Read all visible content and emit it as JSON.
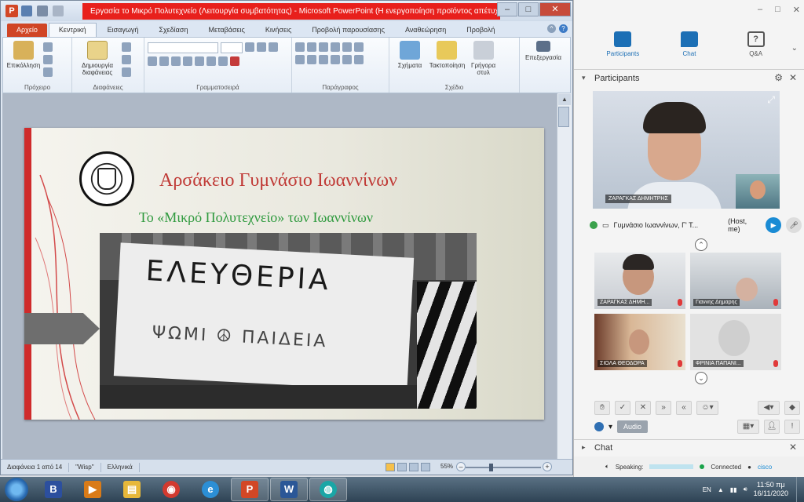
{
  "powerpoint": {
    "app_icon": "P",
    "title": "Εργασία το Μικρό Πολυτεχνείο (Λειτουργία συμβατότητας) - Microsoft PowerPoint (Η ενεργοποίηση προϊόντος απέτυχε)",
    "tabs": [
      "Αρχείο",
      "Κεντρική",
      "Εισαγωγή",
      "Σχεδίαση",
      "Μεταβάσεις",
      "Κινήσεις",
      "Προβολή παρουσίασης",
      "Αναθεώρηση",
      "Προβολή"
    ],
    "active_tab_index": 1,
    "ribbon": {
      "clipboard": {
        "paste_label": "Επικόλληση",
        "group_label": "Πρόχειρο"
      },
      "slides": {
        "new_slide_label": "Δημιουργία διαφάνειας",
        "group_label": "Διαφάνειες"
      },
      "font": {
        "group_label": "Γραμματοσειρά"
      },
      "paragraph": {
        "group_label": "Παράγραφος"
      },
      "drawing": {
        "shapes_label": "Σχήματα",
        "arrange_label": "Τακτοποίηση",
        "quick_styles_label": "Γρήγορα στυλ",
        "group_label": "Σχέδιο"
      },
      "editing": {
        "label": "Επεξεργασία"
      }
    },
    "slide": {
      "heading": "Αρσάκειο Γυμνάσιο Ιωαννίνων",
      "subheading": "Το «Μικρό Πολυτεχνείο» των Ιωαννίνων",
      "photo_banner_text": "ΕΛΕΥΘΕΡΙΑ",
      "photo_banner_text2": "ΨΩΜΙ   ☮   ΠΑΙΔΕΙΑ"
    },
    "status": {
      "slide_counter": "Διαφάνεια 1 από 14",
      "theme": "\"Wisp\"",
      "language": "Ελληνικά",
      "zoom": "55%"
    },
    "colors": {
      "accent_red": "#cf2b2b",
      "heading_red": "#c03a36",
      "subheading_green": "#2f9a3e",
      "file_tab": "#d04525"
    }
  },
  "webex": {
    "tabs": [
      {
        "label": "Participants",
        "icon": "participants-icon"
      },
      {
        "label": "Chat",
        "icon": "chat-icon"
      },
      {
        "label": "Q&A",
        "icon": "qa-icon"
      }
    ],
    "participants_panel_title": "Participants",
    "main_video_name": "ΖΑΡΑΓΚΑΣ ΔΗΜΗΤΡΗΣ",
    "my_status_name": "Γυμνάσιο Ιωαννίνων, Γ' Τ...",
    "my_status_role": "(Host, me)",
    "thumbnails": [
      {
        "name": "ΖΑΡΑΓΚΑΣ ΔΗΜΗ..."
      },
      {
        "name": "Γιαννης Δημαρης"
      },
      {
        "name": "ΣΙΟΛΑ ΘΕΟΔΟΡΑ"
      },
      {
        "name": "ΦΡΙΝΙΑ ΠΑΠΑΝΙ..."
      }
    ],
    "audio_label": "Audio",
    "chat_panel_title": "Chat",
    "footer": {
      "speaking": "Speaking:",
      "connected": "Connected",
      "brand": "cisco"
    },
    "colors": {
      "accent_blue": "#1c6fb5",
      "camera_blue": "#1a8bd4"
    }
  },
  "taskbar": {
    "apps": [
      {
        "name": "blue-b-app-icon",
        "glyph": "B",
        "color": "#2c4f9e"
      },
      {
        "name": "media-player-icon",
        "glyph": "▶",
        "color": "#d97b18"
      },
      {
        "name": "file-explorer-icon",
        "glyph": "▤",
        "color": "#e7b83a"
      },
      {
        "name": "chrome-icon",
        "glyph": "◉",
        "color": "#d23a2f"
      },
      {
        "name": "internet-explorer-icon",
        "glyph": "e",
        "color": "#2c8fd6"
      },
      {
        "name": "powerpoint-icon",
        "glyph": "P",
        "color": "#d24726"
      },
      {
        "name": "word-icon",
        "glyph": "W",
        "color": "#2b5797"
      },
      {
        "name": "webex-icon",
        "glyph": "◍",
        "color": "#1aa6a6"
      }
    ],
    "language": "EN",
    "time": "11:50 πμ",
    "date": "16/11/2020"
  }
}
